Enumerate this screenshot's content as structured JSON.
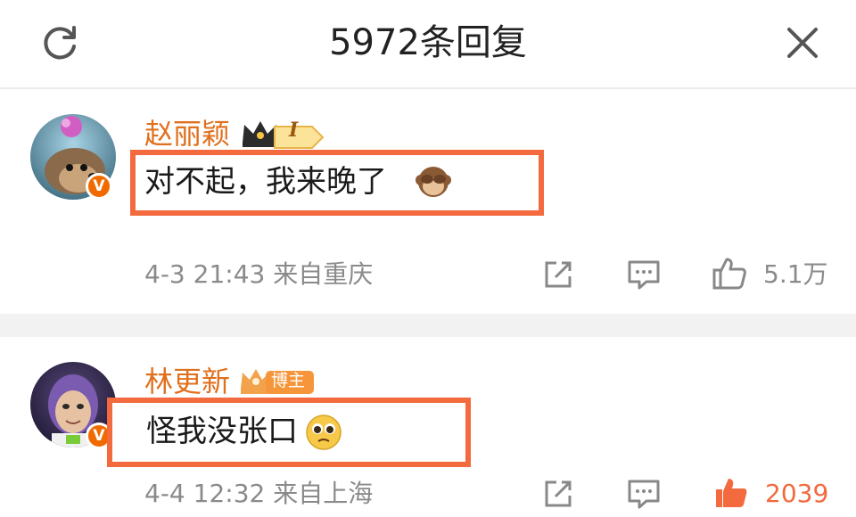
{
  "header": {
    "title": "5972条回复",
    "refresh_icon": "refresh-icon",
    "close_icon": "close-icon"
  },
  "comments": [
    {
      "username": "赵丽颖",
      "badge": {
        "type": "crown-level",
        "label": "I"
      },
      "text": "对不起，我来晚了",
      "emoji": "see-no-evil-monkey-emoji",
      "timestamp": "4-3 21:43",
      "location": "来自重庆",
      "likes": "5.1万",
      "liked": false,
      "verified_badge": "V"
    },
    {
      "username": "林更新",
      "badge": {
        "type": "blogger",
        "label": "博主"
      },
      "text": "怪我没张口",
      "emoji": "pleading-face-emoji",
      "timestamp": "4-4 12:32",
      "location": "来自上海",
      "likes": "2039",
      "liked": true,
      "verified_badge": "V"
    }
  ],
  "colors": {
    "username": "#e0701e",
    "highlight_box": "#f26a3e",
    "meta_text": "#8a8a8a",
    "liked": "#f26a3e",
    "verified": "#f06a00"
  }
}
